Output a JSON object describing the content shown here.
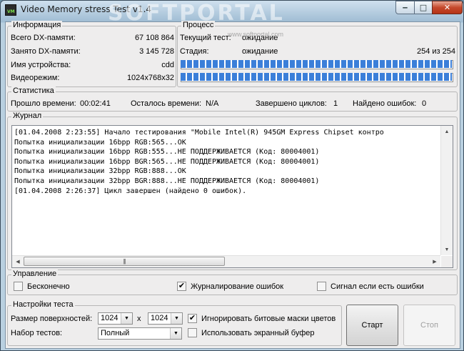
{
  "window": {
    "title": "Video Memory stress Test v1.4",
    "icon_text": "VM",
    "watermark": "SOFTPORTAL",
    "watermark_url": "www.softportal.com",
    "controls": {
      "minimize": "‒",
      "maximize": "□",
      "close": "✕"
    }
  },
  "info": {
    "title": "Информация",
    "rows": [
      {
        "label": "Всего DX-памяти:",
        "value": "67 108 864"
      },
      {
        "label": "Занято DX-памяти:",
        "value": "3 145 728"
      },
      {
        "label": "Имя устройства:",
        "value": "cdd"
      },
      {
        "label": "Видеорежим:",
        "value": "1024x768x32"
      }
    ]
  },
  "process": {
    "title": "Процесс",
    "current_test_label": "Текущий тест:",
    "current_test_value": "ожидание",
    "stage_label": "Стадия:",
    "stage_value": "ожидание",
    "stage_count": "254 из 254",
    "progress1": 1.0,
    "progress2": 1.0
  },
  "stats": {
    "title": "Статистика",
    "elapsed_label": "Прошло времени:",
    "elapsed_value": "00:02:41",
    "remaining_label": "Осталось времени:",
    "remaining_value": "N/A",
    "cycles_label": "Завершено циклов:",
    "cycles_value": "1",
    "errors_label": "Найдено ошибок:",
    "errors_value": "0"
  },
  "journal": {
    "title": "Журнал",
    "lines": [
      "[01.04.2008 2:23:55] Начало тестирования \"Mobile Intel(R) 945GM Express Chipset контро",
      "Попытка инициализации 16bpp RGB:565...OK",
      "Попытка инициализации 16bpp RGB:555...НЕ ПОДДЕРЖИВАЕТСЯ (Код: 80004001)",
      "Попытка инициализации 16bpp BGR:565...НЕ ПОДДЕРЖИВАЕТСЯ (Код: 80004001)",
      "Попытка инициализации 32bpp RGB:888...OK",
      "Попытка инициализации 32bpp BGR:888...НЕ ПОДДЕРЖИВАЕТСЯ (Код: 80004001)",
      "[01.04.2008 2:26:37] Цикл завершен (найдено 0 ошибок)."
    ]
  },
  "control": {
    "title": "Управление",
    "infinite_label": "Бесконечно",
    "infinite_checked": false,
    "logging_label": "Журналирование ошибок",
    "logging_checked": true,
    "beep_label": "Сигнал если есть ошибки",
    "beep_checked": false
  },
  "settings": {
    "title": "Настройки теста",
    "surface_label": "Размер поверхностей:",
    "width_value": "1024",
    "times": "x",
    "height_value": "1024",
    "testset_label": "Набор тестов:",
    "testset_value": "Полный",
    "ignore_masks_label": "Игнорировать битовые маски цветов",
    "ignore_masks_checked": true,
    "screen_buffer_label": "Использовать экранный буфер",
    "screen_buffer_checked": false
  },
  "buttons": {
    "start": "Старт",
    "stop": "Стоп"
  },
  "check_mark": "✔"
}
